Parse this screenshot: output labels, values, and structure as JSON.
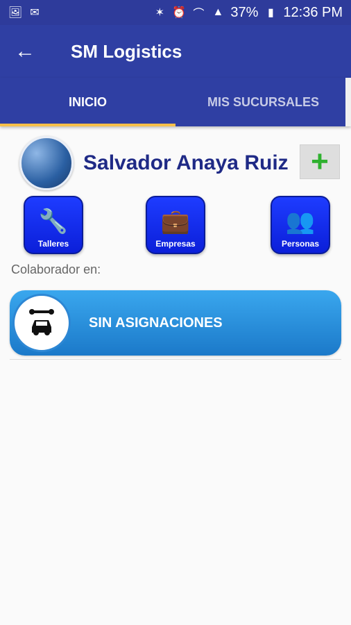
{
  "statusbar": {
    "left_icons": [
      "image-icon",
      "mail-icon"
    ],
    "right_icons": [
      "bluetooth-icon",
      "alarm-icon",
      "wifi-icon",
      "signal-icon",
      "battery-icon"
    ],
    "battery": "37%",
    "time": "12:36 PM"
  },
  "appbar": {
    "title": "SM Logistics"
  },
  "tabs": [
    {
      "label": "INICIO",
      "active": true
    },
    {
      "label": "MIS SUCURSALES",
      "active": false
    }
  ],
  "profile": {
    "name": "Salvador Anaya Ruiz"
  },
  "categories": [
    {
      "label": "Talleres",
      "icon": "wrench-car-icon"
    },
    {
      "label": "Empresas",
      "icon": "briefcase-icon"
    },
    {
      "label": "Personas",
      "icon": "people-icon"
    }
  ],
  "colaborador": {
    "label": "Colaborador en:"
  },
  "assignment": {
    "text": "SIN ASIGNACIONES",
    "icon": "wrench-car-icon"
  },
  "colors": {
    "appbar": "#2f3fa3",
    "tab_indicator": "#f7c04a",
    "accent_blue": "#1b79c9",
    "name": "#1f2a86",
    "plus": "#2fb12f"
  }
}
